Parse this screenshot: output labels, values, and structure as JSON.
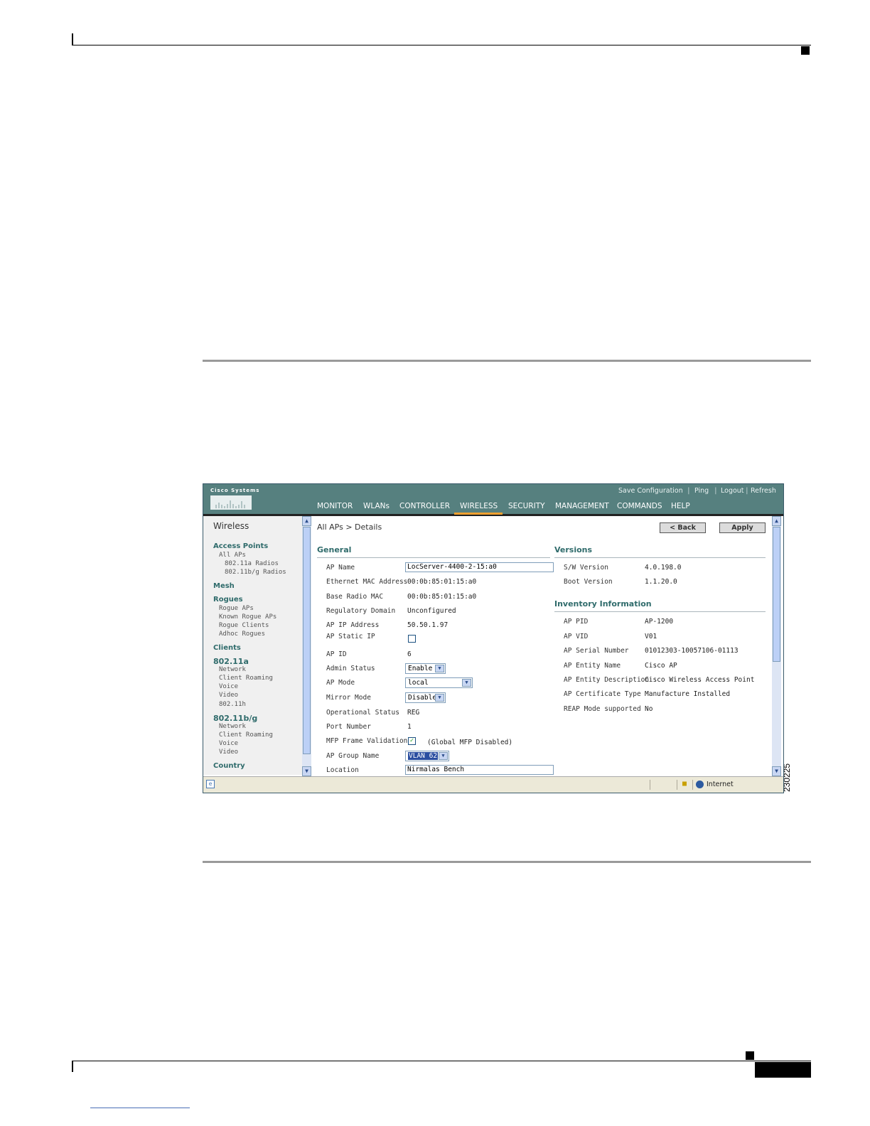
{
  "figure": {
    "id": "230225"
  },
  "banner": {
    "logo_text": "Cisco Systems",
    "top_links": [
      "Save Configuration",
      "Ping",
      "Logout",
      "Refresh"
    ],
    "separator": "|",
    "nav": [
      "MONITOR",
      "WLANs",
      "CONTROLLER",
      "WIRELESS",
      "SECURITY",
      "MANAGEMENT",
      "COMMANDS",
      "HELP"
    ],
    "active_nav": "WIRELESS",
    "accent_color": "#f0a030",
    "banner_color": "#56807f"
  },
  "sidebar": {
    "title": "Wireless",
    "access_points": "Access Points",
    "all_aps": "All APs",
    "radio_a": "802.11a Radios",
    "radio_bg": "802.11b/g Radios",
    "mesh": "Mesh",
    "rogues": "Rogues",
    "rogue_aps": "Rogue APs",
    "known_rogue_aps": "Known Rogue APs",
    "rogue_clients": "Rogue Clients",
    "adhoc_rogues": "Adhoc Rogues",
    "clients": "Clients",
    "a_head": "802.11a",
    "a_network": "Network",
    "a_client_roaming": "Client Roaming",
    "a_voice": "Voice",
    "a_video": "Video",
    "a_80211h": "802.11h",
    "bg_head": "802.11b/g",
    "bg_network": "Network",
    "bg_client_roaming": "Client Roaming",
    "bg_voice": "Voice",
    "bg_video": "Video",
    "country": "Country"
  },
  "main": {
    "breadcrumb": "All APs > Details",
    "back_label": "< Back",
    "apply_label": "Apply",
    "general_title": "General",
    "general": {
      "ap_name_label": "AP Name",
      "ap_name_value": "LocServer-4400-2-15:a0",
      "eth_mac_label": "Ethernet MAC Address",
      "eth_mac_value": "00:0b:85:01:15:a0",
      "base_radio_label": "Base Radio MAC",
      "base_radio_value": "00:0b:85:01:15:a0",
      "reg_domain_label": "Regulatory Domain",
      "reg_domain_value": "Unconfigured",
      "ip_label": "AP IP Address",
      "ip_value": "50.50.1.97",
      "static_ip_label": "AP Static IP",
      "ap_id_label": "AP ID",
      "ap_id_value": "6",
      "admin_status_label": "Admin Status",
      "admin_status_value": "Enable",
      "ap_mode_label": "AP Mode",
      "ap_mode_value": "local",
      "mirror_mode_label": "Mirror Mode",
      "mirror_mode_value": "Disable",
      "op_status_label": "Operational Status",
      "op_status_value": "REG",
      "port_label": "Port Number",
      "port_value": "1",
      "mfp_label": "MFP Frame Validation",
      "mfp_note": "(Global MFP Disabled)",
      "group_label": "AP Group Name",
      "group_value": "VLAN 62",
      "location_label": "Location",
      "location_value": "Nirmalas Bench"
    },
    "versions_title": "Versions",
    "versions": {
      "sw_label": "S/W Version",
      "sw_value": "4.0.198.0",
      "boot_label": "Boot Version",
      "boot_value": "1.1.20.0"
    },
    "inventory_title": "Inventory Information",
    "inventory": {
      "pid_label": "AP PID",
      "pid_value": "AP-1200",
      "vid_label": "AP VID",
      "vid_value": "V01",
      "serial_label": "AP Serial Number",
      "serial_value": "01012303-10057106-01113",
      "entity_name_label": "AP Entity Name",
      "entity_name_value": "Cisco AP",
      "entity_desc_label": "AP Entity Description",
      "entity_desc_value": "Cisco Wireless Access Point",
      "cert_label": "AP Certificate Type",
      "cert_value": "Manufacture Installed",
      "reap_label": "REAP Mode supported",
      "reap_value": "No"
    }
  },
  "statusbar": {
    "zone": "Internet"
  }
}
